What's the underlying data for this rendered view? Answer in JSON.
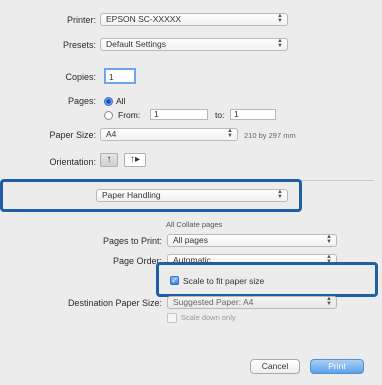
{
  "printer": {
    "label": "Printer:",
    "value": "EPSON SC-XXXXX"
  },
  "presets": {
    "label": "Presets:",
    "value": "Default Settings"
  },
  "copies": {
    "label": "Copies:",
    "value": "1"
  },
  "pages": {
    "label": "Pages:",
    "all_label": "All",
    "from_label": "From:",
    "from_value": "1",
    "to_label": "to:",
    "to_value": "1"
  },
  "paper_size": {
    "label": "Paper Size:",
    "value": "A4",
    "dimensions": "210 by 297 mm"
  },
  "orientation": {
    "label": "Orientation:",
    "portrait_glyph": "↑",
    "landscape_glyph": "↑▸"
  },
  "section_menu": {
    "value": "Paper Handling"
  },
  "collate": {
    "value": "All Collate pages"
  },
  "pages_to_print": {
    "label": "Pages to Print:",
    "value": "All pages"
  },
  "page_order": {
    "label": "Page Order:",
    "value": "Automatic"
  },
  "scale_to_fit": {
    "label": "Scale to fit paper size",
    "checked": true
  },
  "destination_paper_size": {
    "label": "Destination Paper Size:",
    "value": "Suggested Paper: A4"
  },
  "scale_down_only": {
    "label": "Scale down only"
  },
  "buttons": {
    "cancel": "Cancel",
    "print": "Print"
  },
  "colors": {
    "highlight": "#1f5fa8",
    "accent": "#3e7fe0"
  }
}
